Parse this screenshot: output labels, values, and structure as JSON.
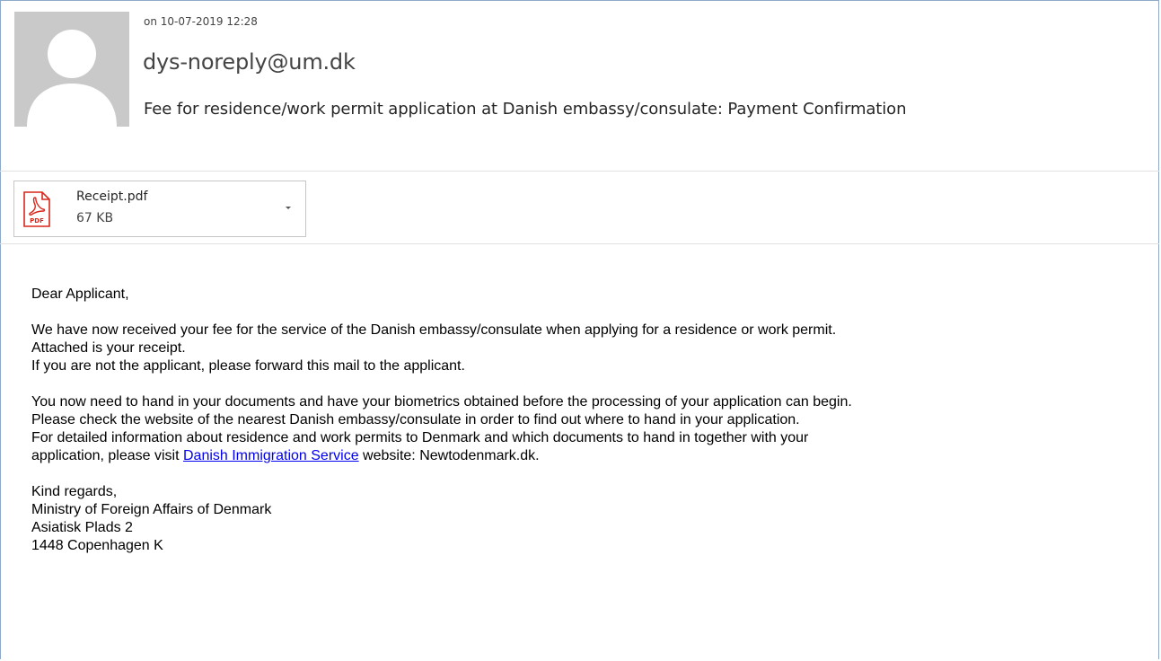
{
  "header": {
    "sent_time": "on 10-07-2019 12:28",
    "sender": "dys-noreply@um.dk",
    "subject": "Fee for residence/work permit application at Danish embassy/consulate: Payment Confirmation",
    "avatar_icon": "person-icon"
  },
  "attachment": {
    "name": "Receipt.pdf",
    "size": "67 KB",
    "icon": "pdf-icon",
    "icon_label": "PDF",
    "menu_icon": "chevron-down-icon"
  },
  "body": {
    "greeting": "Dear Applicant,",
    "p1_l1": "We have now received your fee for the service of the Danish embassy/consulate when applying for a residence or work permit.",
    "p1_l2": "Attached is your receipt.",
    "p1_l3": "If you are not the applicant, please forward this mail to the applicant.",
    "p2_l1": "You now need to hand in your documents and have your biometrics obtained before the processing of your application can begin.",
    "p2_l2": "Please check the website of the nearest Danish embassy/consulate in order to find out where to hand in your application.",
    "p2_l3": "For detailed information about residence and work permits to Denmark and which documents to hand in together with your",
    "p2_l4_before": "application, please visit ",
    "p2_l4_link": "Danish Immigration Service",
    "p2_l4_after": " website: Newtodenmark.dk.",
    "closing": "Kind regards,",
    "sig_l1": "Ministry of Foreign Affairs of Denmark",
    "sig_l2": "Asiatisk Plads 2",
    "sig_l3": "1448 Copenhagen K"
  },
  "colors": {
    "link": "#0000ee",
    "avatar_bg": "#c9c9c9",
    "pdf_red": "#d9261c",
    "frame_border": "#8fa9c9"
  }
}
